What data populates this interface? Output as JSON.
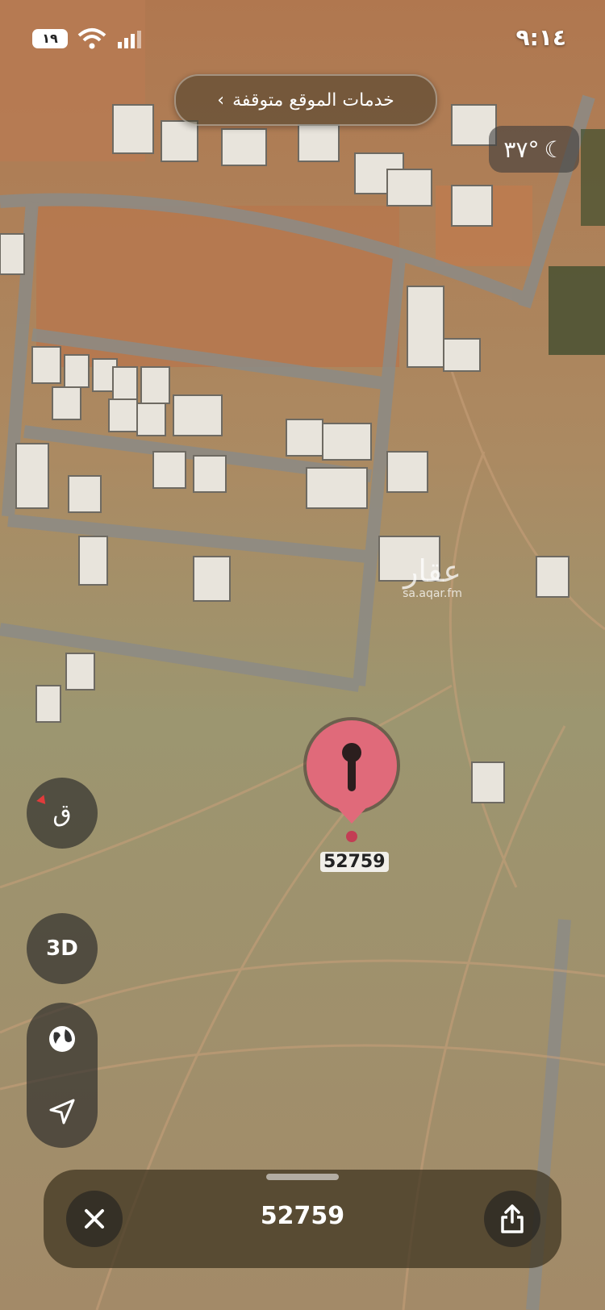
{
  "status": {
    "time": "٩:١٤",
    "battery": "١٩"
  },
  "location_services": {
    "label": "خدمات الموقع متوقفة"
  },
  "weather": {
    "temp": "٣٧°",
    "icon": "moon-stars-icon"
  },
  "compass": {
    "label": "ق"
  },
  "controls": {
    "three_d": "3D",
    "globe_icon": "globe-icon",
    "locate_icon": "navigation-arrow-icon"
  },
  "pin": {
    "label": "52759",
    "color": "#e06a7a"
  },
  "watermark": {
    "brand": "عقار",
    "url": "sa.aqar.fm"
  },
  "bottom_bar": {
    "title": "52759",
    "close_icon": "close-icon",
    "share_icon": "share-icon"
  }
}
